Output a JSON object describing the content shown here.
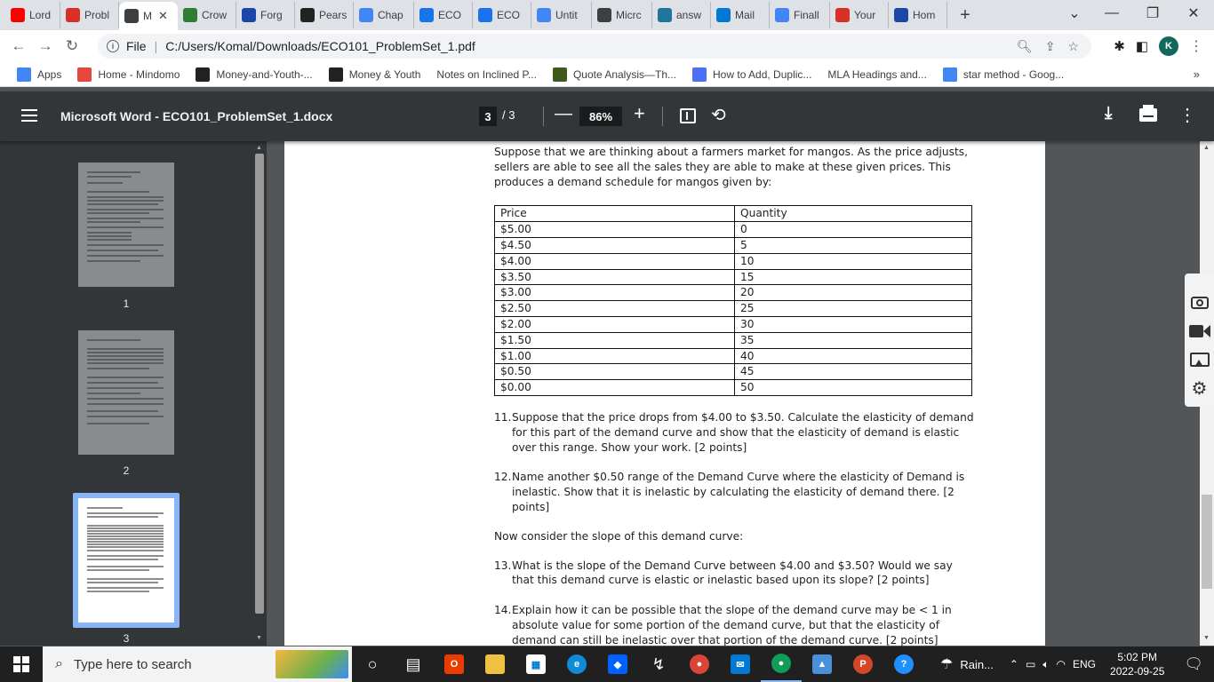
{
  "tabs": [
    {
      "title": "Lord",
      "icon": "youtube-icon",
      "color": "#ff0000"
    },
    {
      "title": "Probl",
      "icon": "loading-icon",
      "color": "#d93025"
    },
    {
      "title": "M",
      "icon": "chrome-globe-icon",
      "color": "#3c4043",
      "active": true
    },
    {
      "title": "Crow",
      "icon": "crowdmark-icon",
      "color": "#2e7d32"
    },
    {
      "title": "Forg",
      "icon": "star-icon",
      "color": "#1a47a8"
    },
    {
      "title": "Pears",
      "icon": "pearson-icon",
      "color": "#222222"
    },
    {
      "title": "Chap",
      "icon": "docs-icon",
      "color": "#4285f4"
    },
    {
      "title": "ECO",
      "icon": "p-icon",
      "color": "#1a73e8"
    },
    {
      "title": "ECO",
      "icon": "p-icon",
      "color": "#1a73e8"
    },
    {
      "title": "Untit",
      "icon": "docs-icon",
      "color": "#4285f4"
    },
    {
      "title": "Micrc",
      "icon": "chrome-globe-icon",
      "color": "#3c4043"
    },
    {
      "title": "answ",
      "icon": "wordpress-icon",
      "color": "#21759b"
    },
    {
      "title": "Mail",
      "icon": "outlook-icon",
      "color": "#0078d4"
    },
    {
      "title": "Finall",
      "icon": "google-icon",
      "color": "#4285f4"
    },
    {
      "title": "Your",
      "icon": "gmail-icon",
      "color": "#d93025"
    },
    {
      "title": "Hom",
      "icon": "star-icon",
      "color": "#1a47a8"
    }
  ],
  "address": {
    "info_label": "File",
    "url": "C:/Users/Komal/Downloads/ECO101_ProblemSet_1.pdf"
  },
  "profile_initial": "K",
  "bookmarks": [
    {
      "label": "Apps",
      "icon": "apps-grid-icon",
      "color": "#4285f4"
    },
    {
      "label": "Home - Mindomo",
      "icon": "mindomo-icon",
      "color": "#e8453c"
    },
    {
      "label": "Money-and-Youth-...",
      "icon": "globe-icon",
      "color": "#222222"
    },
    {
      "label": "Money & Youth",
      "icon": "globe-icon",
      "color": "#222222"
    },
    {
      "label": "Notes on Inclined P...",
      "icon": "blank-page-icon",
      "color": "#ffffff"
    },
    {
      "label": "Quote Analysis—Th...",
      "icon": "site-icon",
      "color": "#3b5a1c"
    },
    {
      "label": "How to Add, Duplic...",
      "icon": "site-icon",
      "color": "#4c6ef5"
    },
    {
      "label": "MLA Headings and...",
      "icon": "blank-page-icon",
      "color": "#ffffff"
    },
    {
      "label": "star method - Goog...",
      "icon": "google-icon",
      "color": "#4285f4"
    }
  ],
  "pdf": {
    "title": "Microsoft Word - ECO101_ProblemSet_1.docx",
    "current_page": "3",
    "total_pages": "/ 3",
    "zoom": "86%",
    "thumbnails": [
      "1",
      "2",
      "3"
    ]
  },
  "document": {
    "intro": "Suppose that we are thinking about a farmers market for mangos. As the price adjusts, sellers are able to see all the sales they are able to make at these given prices. This produces a demand schedule for mangos given by:",
    "table_headers": [
      "Price",
      "Quantity"
    ],
    "table_rows": [
      [
        "$5.00",
        "0"
      ],
      [
        "$4.50",
        "5"
      ],
      [
        "$4.00",
        "10"
      ],
      [
        "$3.50",
        "15"
      ],
      [
        "$3.00",
        "20"
      ],
      [
        "$2.50",
        "25"
      ],
      [
        "$2.00",
        "30"
      ],
      [
        "$1.50",
        "35"
      ],
      [
        "$1.00",
        "40"
      ],
      [
        "$0.50",
        "45"
      ],
      [
        "$0.00",
        "50"
      ]
    ],
    "questions_a": [
      {
        "num": "11.",
        "text": "Suppose that the price drops from $4.00 to $3.50. Calculate the elasticity of demand for this part of the demand curve and show that the elasticity of demand is elastic over this range. Show your work. [2 points]"
      },
      {
        "num": "12.",
        "text": "Name another $0.50 range of the Demand Curve where the elasticity of Demand is inelastic. Show that it is inelastic by calculating the elasticity of demand there. [2 points]"
      }
    ],
    "slope_intro": "Now consider the slope of this demand curve:",
    "questions_b": [
      {
        "num": "13.",
        "text": "What is the slope of the Demand Curve between $4.00 and $3.50? Would we say that this demand curve is elastic or inelastic based upon its slope? [2 points]"
      },
      {
        "num": "14.",
        "text": "Explain how it can be possible that the slope of the demand curve may be < 1 in absolute value for some portion of the demand curve, but that the elasticity of demand can still be inelastic over that portion of the demand curve. [2 points]"
      }
    ]
  },
  "taskbar": {
    "search_placeholder": "Type here to search",
    "weather": "Rain...",
    "language": "ENG",
    "time": "5:02 PM",
    "date": "2022-09-25"
  }
}
